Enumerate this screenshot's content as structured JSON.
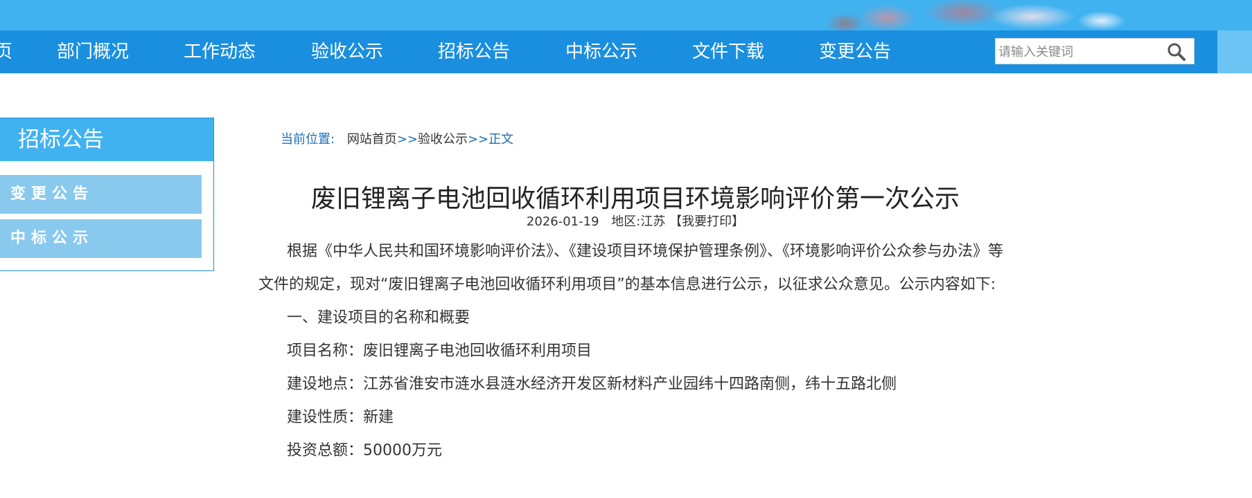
{
  "nav": {
    "items": [
      "页",
      "部门概况",
      "工作动态",
      "验收公示",
      "招标公告",
      "中标公示",
      "文件下载",
      "变更公告"
    ],
    "search_placeholder": "请输入关键词"
  },
  "sidebar": {
    "title": "招标公告",
    "items": [
      "变更公告",
      "中标公示"
    ]
  },
  "breadcrumb": {
    "label": "当前位置:",
    "home": "网站首页",
    "sep1": ">>",
    "category": "验收公示",
    "sep2": ">>",
    "current": "正文"
  },
  "article": {
    "title": "废旧锂离子电池回收循环利用项目环境影响评价第一次公示",
    "date": "2026-01-19",
    "region_label": "地区:",
    "region": "江苏",
    "print": "【我要打印】",
    "intro": "根据《中华人民共和国环境影响评价法》、《建设项目环境保护管理条例》、《环境影响评价公众参与办法》等文件的规定，现对“废旧锂离子电池回收循环利用项目”的基本信息进行公示，以征求公众意见。公示内容如下:",
    "section1": "一、建设项目的名称和概要",
    "name_line": "项目名称：废旧锂离子电池回收循环利用项目",
    "location_line": "建设地点：江苏省淮安市涟水县涟水经济开发区新材料产业园纬十四路南侧，纬十五路北侧",
    "nature_line": "建设性质：新建",
    "investment_line": "投资总额：50000万元"
  }
}
